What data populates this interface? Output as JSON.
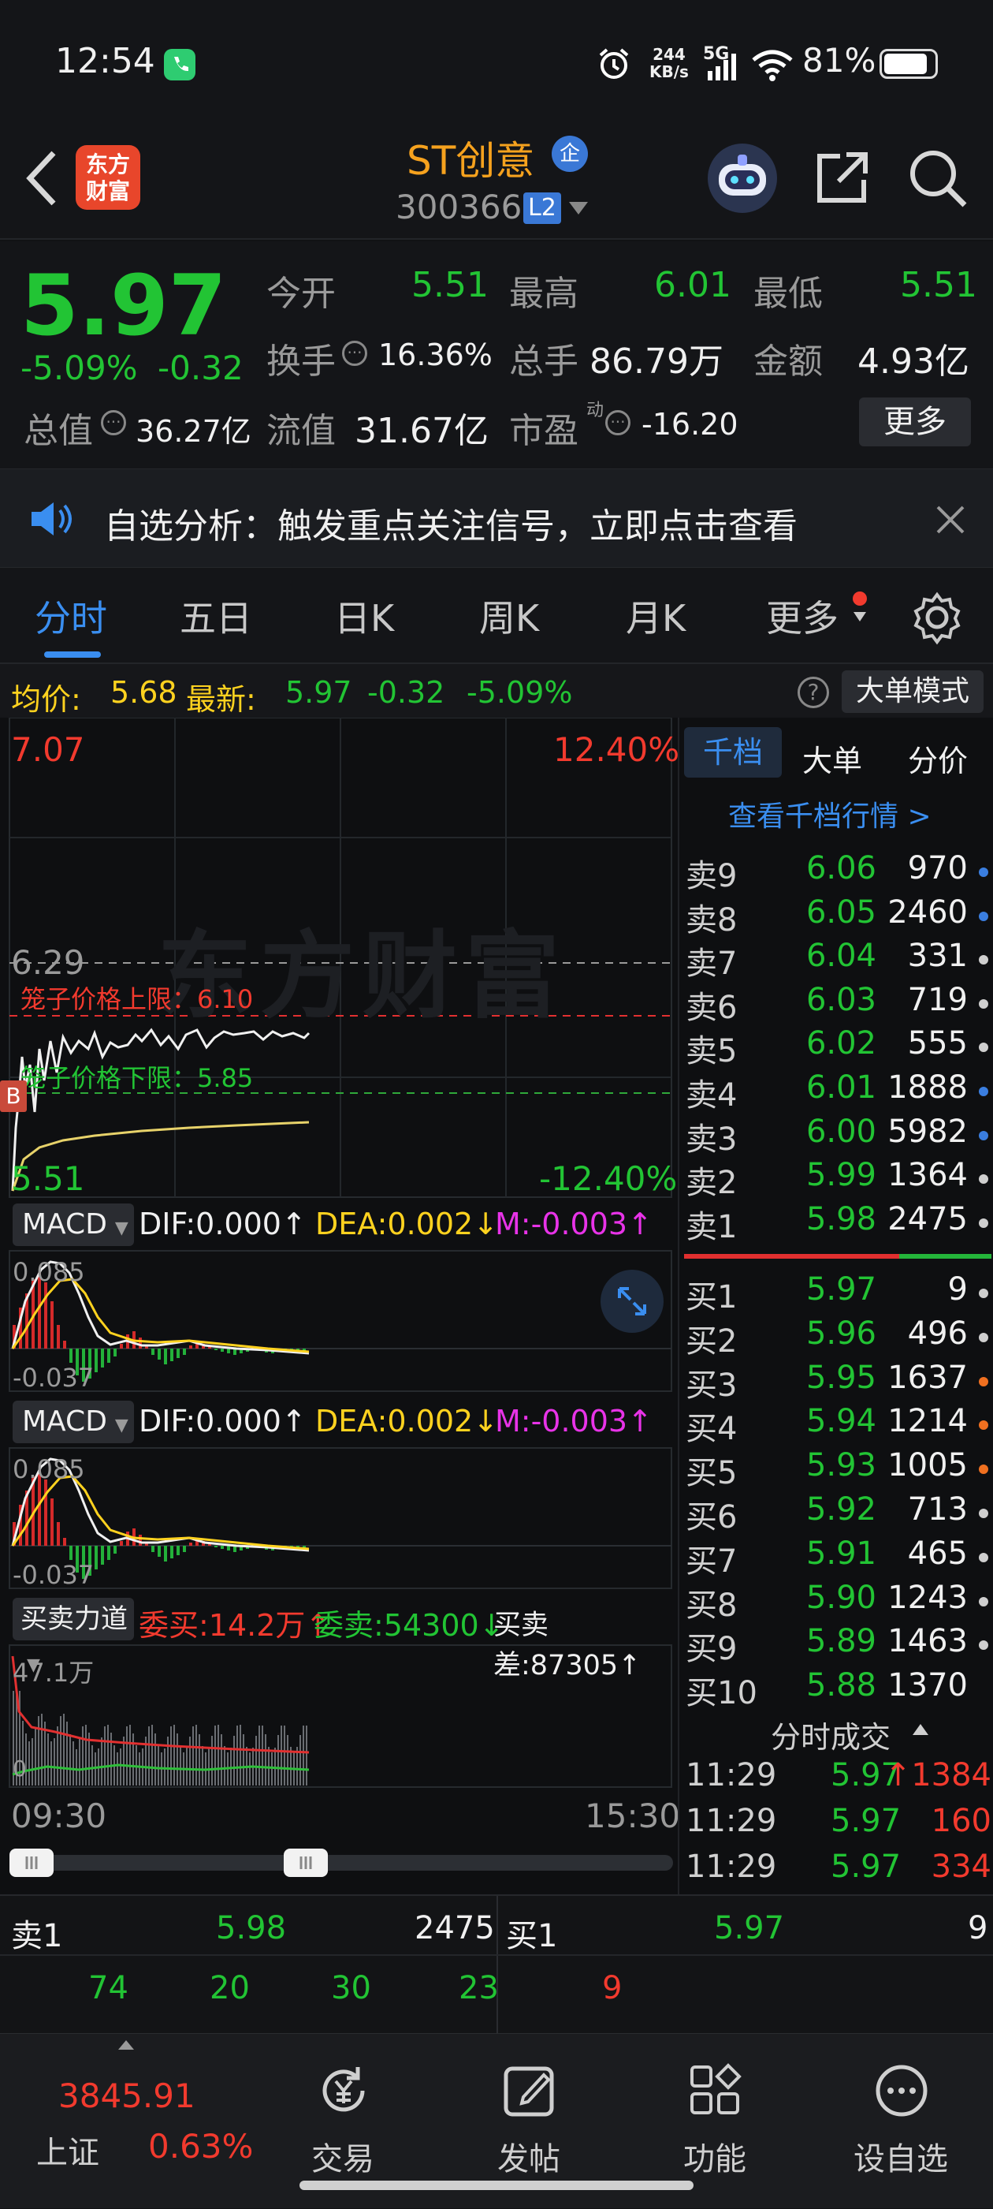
{
  "status_bar": {
    "time": "12:54",
    "net_speed_top": "244",
    "net_speed_unit": "KB/s",
    "network": "5G",
    "battery": "81%"
  },
  "header": {
    "logo_line1": "东方",
    "logo_line2": "财富",
    "stock_name": "ST创意",
    "badge": "企",
    "code": "300366",
    "level": "L2"
  },
  "quote": {
    "price": "5.97",
    "change_pct": "-5.09%",
    "change": "-0.32",
    "open_label": "今开",
    "open": "5.51",
    "high_label": "最高",
    "high": "6.01",
    "low_label": "最低",
    "low": "5.51",
    "turnover_label": "换手",
    "turnover": "16.36%",
    "volume_label": "总手",
    "volume": "86.79万",
    "amount_label": "金额",
    "amount": "4.93亿",
    "mktcap_label": "总值",
    "mktcap": "36.27亿",
    "float_label": "流值",
    "float": "31.67亿",
    "pe_label": "市盈",
    "pe_sup": "动",
    "pe": "-16.20",
    "more": "更多"
  },
  "notice": {
    "text": "自选分析：触发重点关注信号，立即点击查看"
  },
  "tabs": [
    "分时",
    "五日",
    "日K",
    "周K",
    "月K",
    "更多"
  ],
  "infobar": {
    "avg_label": "均价:",
    "avg": "5.68",
    "last_label": "最新:",
    "last": "5.97",
    "chg": "-0.32",
    "pct": "-5.09%",
    "mode": "大单模式"
  },
  "chart": {
    "top_price": "7.07",
    "top_pct": "12.40%",
    "bottom_price": "5.51",
    "bottom_pct": "-12.40%",
    "mid_price": "6.29",
    "cage_upper": "笼子价格上限：6.10",
    "cage_lower": "笼子价格下限：5.85",
    "watermark": "东方财富",
    "macd_label": "MACD",
    "dif": "DIF:0.000",
    "dea": "DEA:0.002",
    "m": "M:-0.003",
    "macd_high": "0.085",
    "macd_low": "-0.037",
    "bs_label": "买卖力道",
    "entrust_buy": "委买:14.2万",
    "entrust_sell": "委卖:54300",
    "diff": "买卖差:87305",
    "bs_max": "47.1万",
    "bs_zero": "0",
    "time_start": "09:30",
    "time_end": "15:30",
    "marker": "B"
  },
  "orderbook": {
    "tabs": [
      "千档",
      "大单",
      "分价"
    ],
    "link": "查看千档行情 >",
    "asks": [
      {
        "label": "卖9",
        "price": "6.06",
        "vol": "970",
        "dot": "#3a7ee0"
      },
      {
        "label": "卖8",
        "price": "6.05",
        "vol": "2460",
        "dot": "#3a7ee0"
      },
      {
        "label": "卖7",
        "price": "6.04",
        "vol": "331",
        "dot": "#cfcfcf"
      },
      {
        "label": "卖6",
        "price": "6.03",
        "vol": "719",
        "dot": "#cfcfcf"
      },
      {
        "label": "卖5",
        "price": "6.02",
        "vol": "555",
        "dot": "#cfcfcf"
      },
      {
        "label": "卖4",
        "price": "6.01",
        "vol": "1888",
        "dot": "#3a7ee0"
      },
      {
        "label": "卖3",
        "price": "6.00",
        "vol": "5982",
        "dot": "#3a7ee0"
      },
      {
        "label": "卖2",
        "price": "5.99",
        "vol": "1364",
        "dot": "#cfcfcf"
      },
      {
        "label": "卖1",
        "price": "5.98",
        "vol": "2475",
        "dot": "#cfcfcf"
      }
    ],
    "bids": [
      {
        "label": "买1",
        "price": "5.97",
        "vol": "9",
        "dot": "#cfcfcf"
      },
      {
        "label": "买2",
        "price": "5.96",
        "vol": "496",
        "dot": "#cfcfcf"
      },
      {
        "label": "买3",
        "price": "5.95",
        "vol": "1637",
        "dot": "#f07020"
      },
      {
        "label": "买4",
        "price": "5.94",
        "vol": "1214",
        "dot": "#f07020"
      },
      {
        "label": "买5",
        "price": "5.93",
        "vol": "1005",
        "dot": "#f07020"
      },
      {
        "label": "买6",
        "price": "5.92",
        "vol": "713",
        "dot": "#cfcfcf"
      },
      {
        "label": "买7",
        "price": "5.91",
        "vol": "465",
        "dot": "#cfcfcf"
      },
      {
        "label": "买8",
        "price": "5.90",
        "vol": "1243",
        "dot": "#cfcfcf"
      },
      {
        "label": "买9",
        "price": "5.89",
        "vol": "1463",
        "dot": "#cfcfcf"
      },
      {
        "label": "买10",
        "price": "5.88",
        "vol": "1370",
        "dot": ""
      }
    ],
    "trades_title": "分时成交",
    "trades": [
      {
        "time": "11:29",
        "price": "5.97",
        "vol": "1384"
      },
      {
        "time": "11:29",
        "price": "5.97",
        "vol": "160"
      },
      {
        "time": "11:29",
        "price": "5.97",
        "vol": "334"
      }
    ]
  },
  "bottom_book": {
    "sell_label": "卖1",
    "sell_price": "5.98",
    "sell_vol": "2475",
    "buy_label": "买1",
    "buy_price": "5.97",
    "buy_vol": "9",
    "sell_queue": [
      "74",
      "20",
      "30",
      "23"
    ],
    "buy_queue": [
      "9"
    ]
  },
  "nav": {
    "index_value": "3845.91",
    "index_name": "上证",
    "index_pct": "0.63%",
    "items": [
      "交易",
      "发帖",
      "功能",
      "设自选"
    ]
  }
}
